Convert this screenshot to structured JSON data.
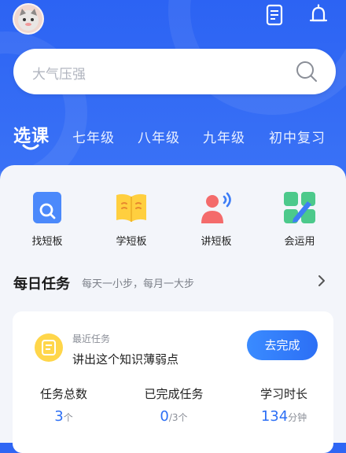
{
  "header": {
    "search_placeholder": "大气压强"
  },
  "tabs": [
    {
      "label": "选课"
    },
    {
      "label": "七年级"
    },
    {
      "label": "八年级"
    },
    {
      "label": "九年级"
    },
    {
      "label": "初中复习"
    }
  ],
  "features": [
    {
      "label": "找短板",
      "icon": "search-board-icon"
    },
    {
      "label": "学短板",
      "icon": "book-icon"
    },
    {
      "label": "讲短板",
      "icon": "speaker-person-icon"
    },
    {
      "label": "会运用",
      "icon": "apply-grid-icon"
    }
  ],
  "daily": {
    "title": "每日任务",
    "subtitle": "每天一小步，每月一大步"
  },
  "task": {
    "label": "最近任务",
    "text": "讲出这个知识薄弱点",
    "button": "去完成"
  },
  "stats": [
    {
      "label": "任务总数",
      "value": "3",
      "unit": "个"
    },
    {
      "label": "已完成任务",
      "value": "0",
      "unit": "/3个"
    },
    {
      "label": "学习时长",
      "value": "134",
      "unit": "分钟"
    }
  ],
  "colors": {
    "primary": "#2c63f3",
    "accent_blue": "#2c6ff5",
    "task_badge": "#ffd64a",
    "panel_bg": "#f3f5fa"
  }
}
